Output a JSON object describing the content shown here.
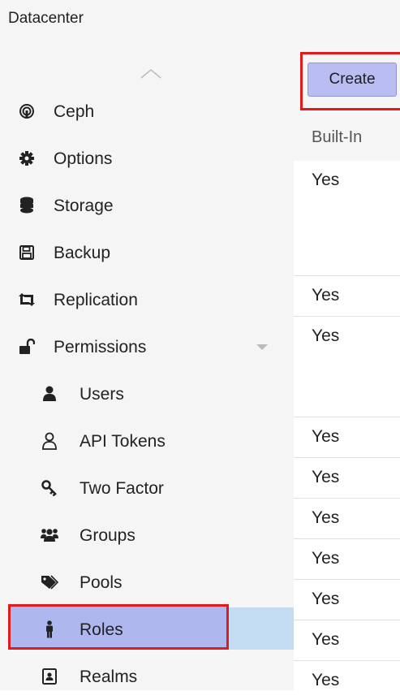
{
  "header": {
    "title": "Datacenter"
  },
  "sidebar": {
    "items": [
      {
        "label": "Ceph",
        "icon": "ceph-icon"
      },
      {
        "label": "Options",
        "icon": "gear-icon"
      },
      {
        "label": "Storage",
        "icon": "database-icon"
      },
      {
        "label": "Backup",
        "icon": "floppy-icon"
      },
      {
        "label": "Replication",
        "icon": "retweet-icon"
      },
      {
        "label": "Permissions",
        "icon": "unlock-icon"
      },
      {
        "label": "Users",
        "icon": "user-icon"
      },
      {
        "label": "API Tokens",
        "icon": "user-outline-icon"
      },
      {
        "label": "Two Factor",
        "icon": "key-icon"
      },
      {
        "label": "Groups",
        "icon": "users-icon"
      },
      {
        "label": "Pools",
        "icon": "tags-icon"
      },
      {
        "label": "Roles",
        "icon": "male-icon"
      },
      {
        "label": "Realms",
        "icon": "address-book-icon"
      }
    ],
    "selected": "Roles"
  },
  "toolbar": {
    "create_label": "Create"
  },
  "grid": {
    "column_header": "Built-In",
    "rows": [
      "Yes",
      "Yes",
      "Yes",
      "Yes",
      "Yes",
      "Yes",
      "Yes",
      "Yes",
      "Yes",
      "Yes"
    ]
  },
  "colors": {
    "highlight": "#e01b1b",
    "selected_bg": "#c4dcf2",
    "button_bg": "#b9bdf2"
  }
}
